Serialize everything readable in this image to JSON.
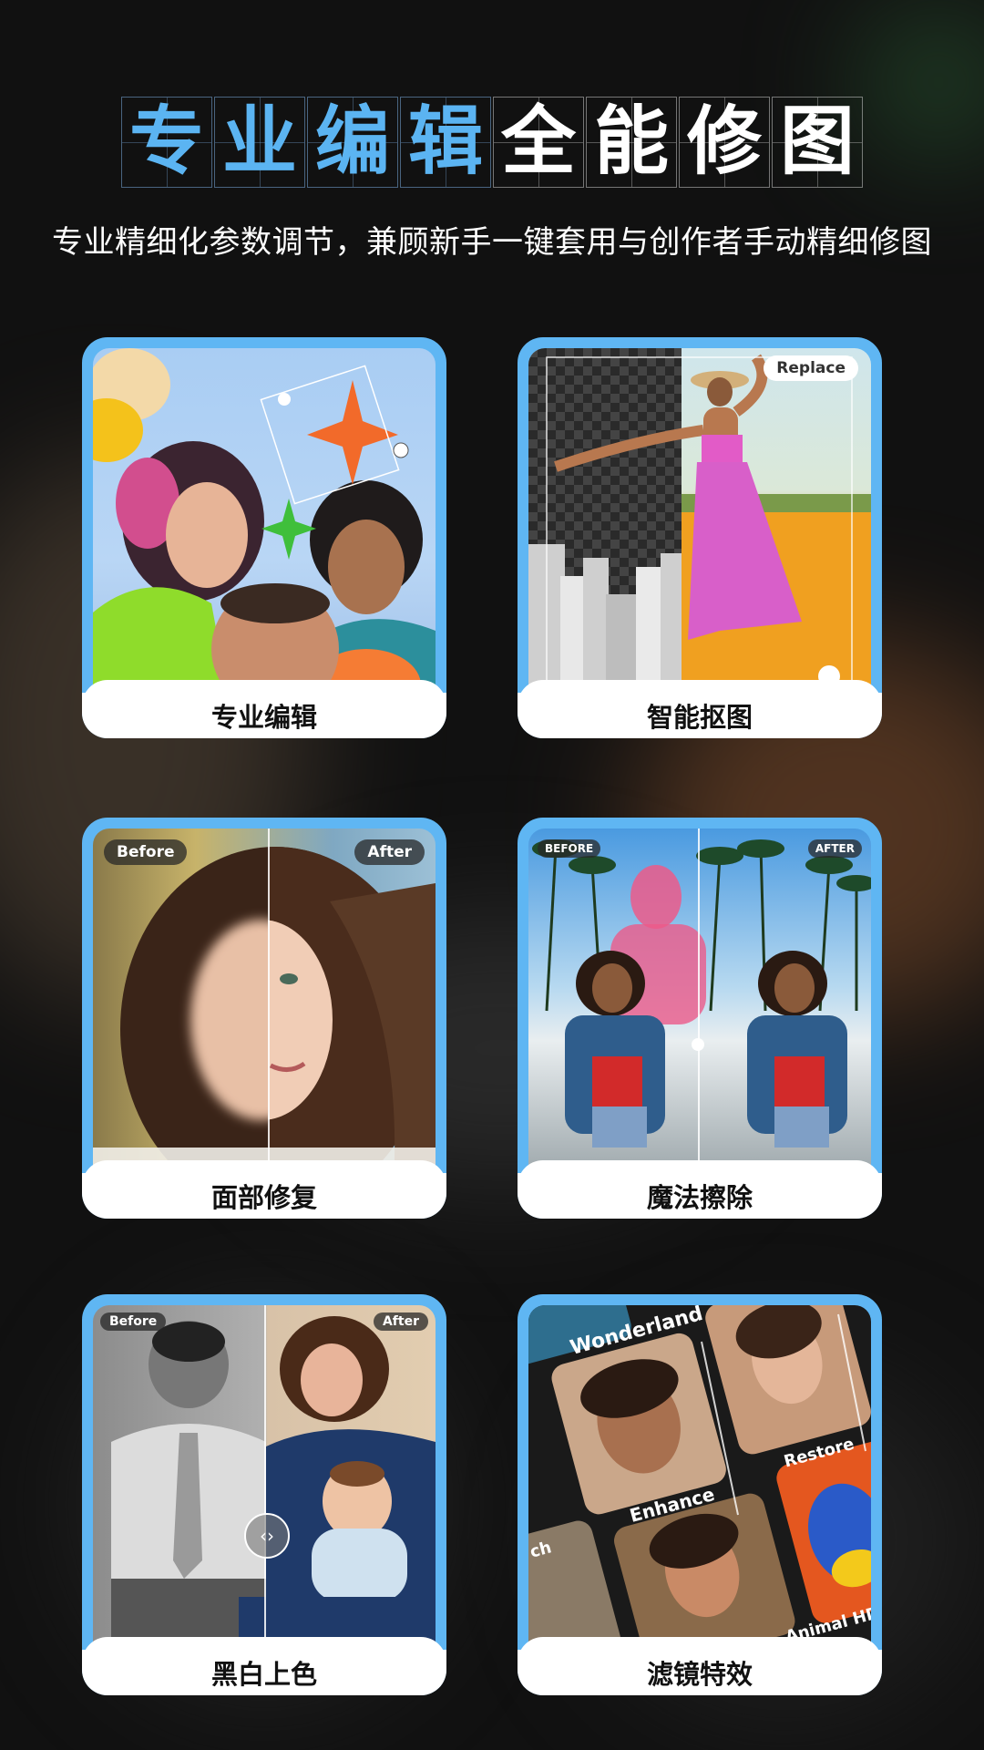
{
  "title": {
    "blue_chars": [
      "专",
      "业",
      "编",
      "辑"
    ],
    "white_chars": [
      "全",
      "能",
      "修",
      "图"
    ]
  },
  "subtitle": "专业精细化参数调节，兼顾新手一键套用与创作者手动精细修图",
  "cards": [
    {
      "label": "专业编辑"
    },
    {
      "label": "智能抠图",
      "chips": {
        "replace": "Replace"
      }
    },
    {
      "label": "面部修复",
      "chips": {
        "before": "Before",
        "after": "After"
      }
    },
    {
      "label": "魔法擦除",
      "chips": {
        "before": "BEFORE",
        "after": "AFTER"
      }
    },
    {
      "label": "黑白上色",
      "chips": {
        "before": "Before",
        "after": "After"
      }
    },
    {
      "label": "滤镜特效",
      "tiles": [
        "Wonderland",
        "Restore",
        "Enhance",
        "ch",
        "Animal HD"
      ]
    }
  ],
  "colors": {
    "accent": "#5fb6f3",
    "title_blue": "#5bb4f2",
    "background": "#111111"
  }
}
